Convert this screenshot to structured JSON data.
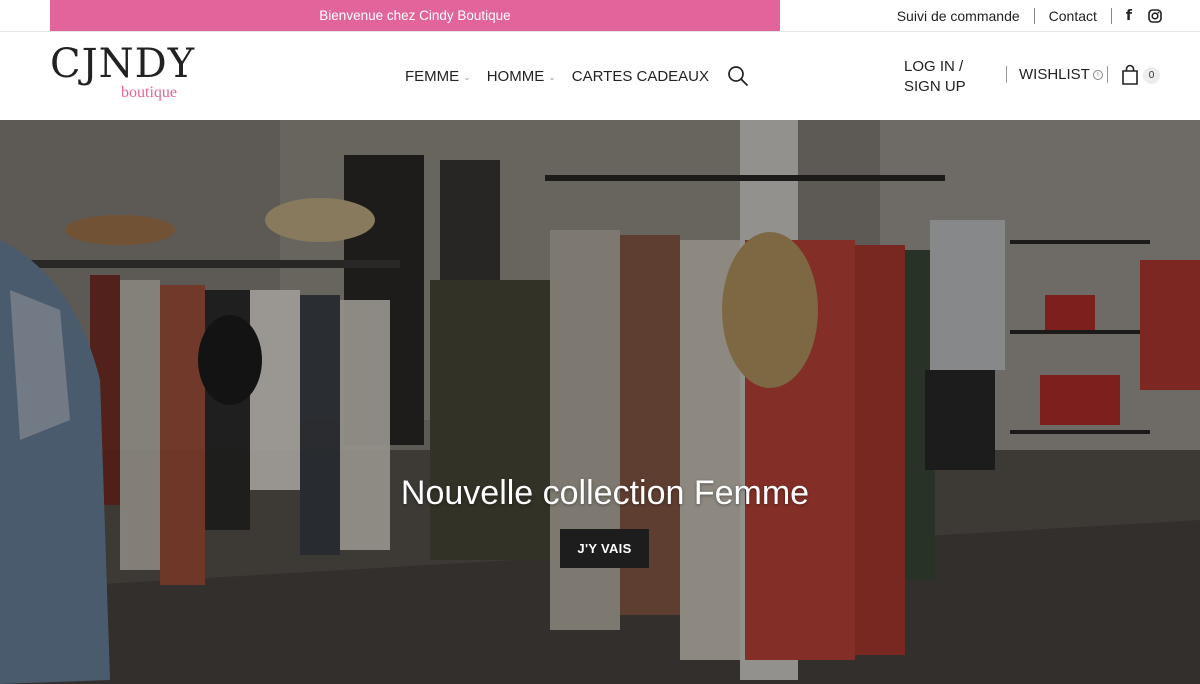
{
  "topbar": {
    "promo_text": "Bienvenue chez Cindy Boutique",
    "links": [
      "Suivi de commande",
      "Contact"
    ],
    "social": [
      {
        "icon": "facebook-icon"
      },
      {
        "icon": "instagram-icon"
      }
    ]
  },
  "header": {
    "logo_main": "CJNDY",
    "logo_sub": "boutique",
    "nav": [
      "FEMME",
      "HOMME",
      "CARTES CADEAUX"
    ],
    "account_label": "LOG IN / SIGN UP",
    "wishlist_label": "WISHLIST",
    "cart_count": "0"
  },
  "hero": {
    "title": "Nouvelle collection Femme",
    "button_label": "J'Y VAIS"
  },
  "colors": {
    "brand_pink": "#e1659a",
    "button_dark": "#1d1d1d"
  }
}
